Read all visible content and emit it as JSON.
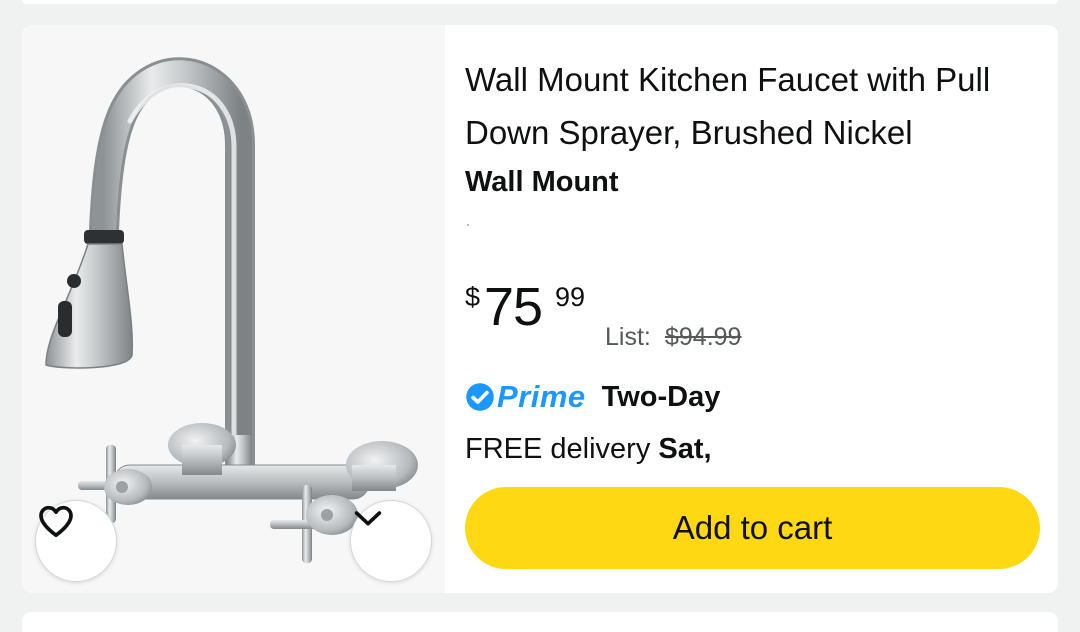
{
  "product": {
    "title": "Wall Mount Kitchen Faucet with Pull Down Sprayer, Brushed Nickel",
    "variant": "Wall Mount",
    "price": {
      "symbol": "$",
      "whole": "75",
      "fraction": "99",
      "list_label": "List:",
      "list_price": "$94.99"
    },
    "prime": {
      "label": "Prime",
      "speed": "Two-Day"
    },
    "delivery": {
      "prefix": "FREE delivery",
      "day": "Sat,"
    },
    "add_to_cart_label": "Add to cart"
  },
  "icons": {
    "wishlist": "heart-icon",
    "more": "chevron-down-icon",
    "prime_badge": "check-circle-icon"
  },
  "colors": {
    "cart_button": "#ffd814",
    "prime_blue": "#1a98ff",
    "muted_text": "#565959"
  }
}
